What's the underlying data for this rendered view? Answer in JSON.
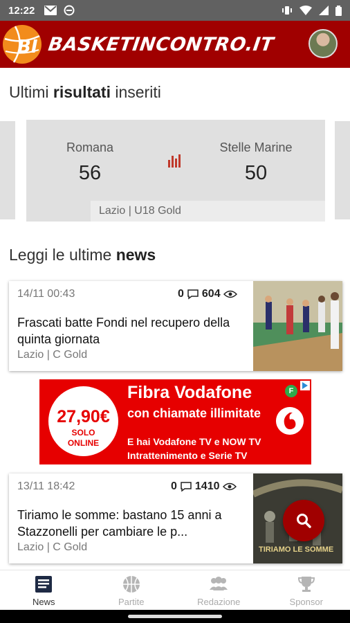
{
  "status_bar": {
    "time": "12:22"
  },
  "header": {
    "logo_text": "BI",
    "brand": "BASKETINCONTRO.IT"
  },
  "results_section": {
    "title_pre": "Ultimi ",
    "title_bold": "risultati",
    "title_post": " inseriti"
  },
  "result": {
    "home_team": "Romana",
    "home_score": "56",
    "away_team": "Stelle Marine",
    "away_score": "50",
    "league": "Lazio | U18 Gold"
  },
  "news_section": {
    "title_pre": "Leggi le ultime ",
    "title_bold": "news"
  },
  "news": [
    {
      "date": "14/11 00:43",
      "comments": "0",
      "views": "604",
      "headline": "Frascati batte Fondi nel recupero della quinta giornata",
      "category": "Lazio | C Gold"
    },
    {
      "date": "13/11 18:42",
      "comments": "0",
      "views": "1410",
      "headline": "Tiriamo le somme: bastano 15 anni a Stazzonelli per cambiare le p...",
      "category": "Lazio | C Gold",
      "thumb_caption": "TIRIAMO LE SOMME"
    }
  ],
  "ad": {
    "price": "27,90€",
    "price_note_1": "SOLO",
    "price_note_2": "ONLINE",
    "title": "Fibra Vodafone",
    "subtitle": "con chiamate illimitate",
    "line1": "E hai Vodafone TV e NOW TV",
    "line2": "Intrattenimento e Serie TV",
    "badge": "F"
  },
  "bottom_nav": [
    {
      "label": "News",
      "icon": "news-icon",
      "active": true
    },
    {
      "label": "Partite",
      "icon": "basketball-icon",
      "active": false
    },
    {
      "label": "Redazione",
      "icon": "people-icon",
      "active": false
    },
    {
      "label": "Sponsor",
      "icon": "trophy-icon",
      "active": false
    }
  ],
  "colors": {
    "brand_red": "#a00000",
    "status_bar": "#616161",
    "ad_red": "#e60000"
  }
}
